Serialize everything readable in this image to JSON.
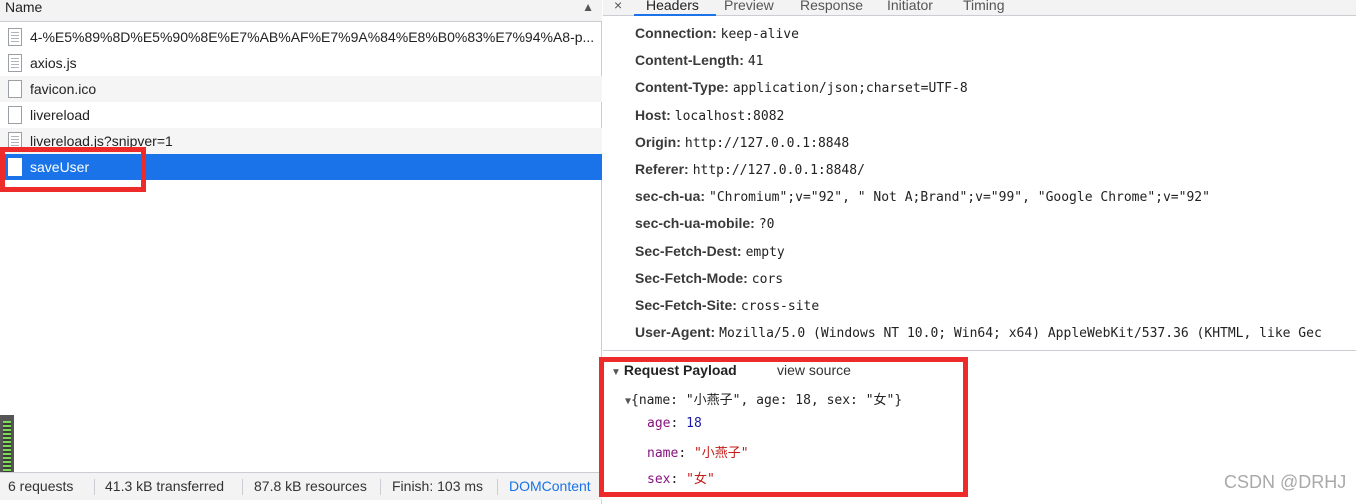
{
  "request_list": {
    "column_header": "Name",
    "sort_indicator": "▲",
    "rows": [
      {
        "name": "4-%E5%89%8D%E5%90%8E%E7%AB%AF%E7%9A%84%E8%B0%83%E7%94%A8-p..."
      },
      {
        "name": "axios.js"
      },
      {
        "name": "favicon.ico"
      },
      {
        "name": "livereload"
      },
      {
        "name": "livereload.js?snipver=1"
      },
      {
        "name": "saveUser"
      }
    ],
    "selected": "saveUser"
  },
  "status_bar": {
    "requests": "6 requests",
    "transferred": "41.3 kB transferred",
    "resources": "87.8 kB resources",
    "finish": "Finish: 103 ms",
    "dom_content": "DOMContent"
  },
  "detail_tabs": {
    "close": "×",
    "tabs": [
      "Headers",
      "Preview",
      "Response",
      "Initiator",
      "Timing"
    ],
    "active": "Headers"
  },
  "request_headers": [
    {
      "key": "Connection:",
      "value": "keep-alive"
    },
    {
      "key": "Content-Length:",
      "value": "41"
    },
    {
      "key": "Content-Type:",
      "value": "application/json;charset=UTF-8"
    },
    {
      "key": "Host:",
      "value": "localhost:8082"
    },
    {
      "key": "Origin:",
      "value": "http://127.0.0.1:8848"
    },
    {
      "key": "Referer:",
      "value": "http://127.0.0.1:8848/"
    },
    {
      "key": "sec-ch-ua:",
      "value": "\"Chromium\";v=\"92\", \" Not A;Brand\";v=\"99\", \"Google Chrome\";v=\"92\""
    },
    {
      "key": "sec-ch-ua-mobile:",
      "value": "?0"
    },
    {
      "key": "Sec-Fetch-Dest:",
      "value": "empty"
    },
    {
      "key": "Sec-Fetch-Mode:",
      "value": "cors"
    },
    {
      "key": "Sec-Fetch-Site:",
      "value": "cross-site"
    },
    {
      "key": "User-Agent:",
      "value": "Mozilla/5.0 (Windows NT 10.0; Win64; x64) AppleWebKit/537.36 (KHTML, like Gec"
    }
  ],
  "payload": {
    "title": "Request Payload",
    "view_source": "view source",
    "summary": "{name: \"小燕子\", age: 18, sex: \"女\"}",
    "fields": [
      {
        "key": "age",
        "value": "18",
        "type": "number"
      },
      {
        "key": "name",
        "value": "\"小燕子\"",
        "type": "string"
      },
      {
        "key": "sex",
        "value": "\"女\"",
        "type": "string"
      }
    ]
  },
  "watermark": "CSDN @DRHJ",
  "colors": {
    "selection": "#1a73e8",
    "annotation": "#ed2b2b",
    "key_purple": "#881280",
    "number_blue": "#1a1aa6",
    "string_red": "#c41a16"
  }
}
